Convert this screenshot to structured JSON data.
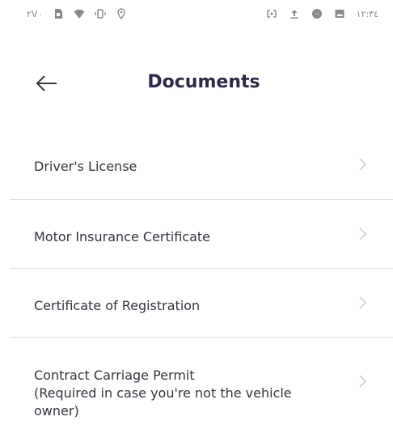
{
  "status_bar": {
    "left_text": "۲V۰",
    "time": "۱۲:۳٤"
  },
  "header": {
    "title": "Documents"
  },
  "documents": [
    {
      "label": "Driver's License"
    },
    {
      "label": "Motor Insurance Certificate"
    },
    {
      "label": "Certificate of Registration"
    },
    {
      "label": "Contract Carriage Permit\n(Required in case you're not the vehicle owner)"
    }
  ],
  "colors": {
    "title": "#2d2a45",
    "text": "#333340",
    "divider": "#dedede",
    "chevron": "#d0d0d0",
    "status_icons": "#8a8a8a"
  }
}
